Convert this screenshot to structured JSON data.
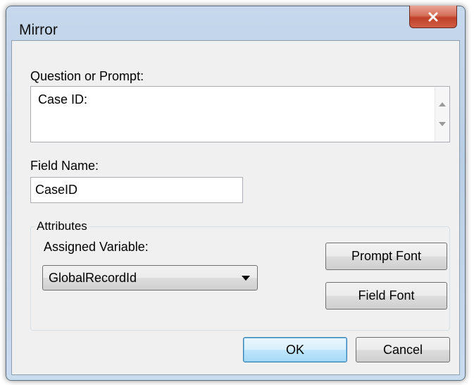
{
  "window": {
    "title": "Mirror",
    "close_glyph": "✕"
  },
  "prompt": {
    "label": "Question or Prompt:",
    "value": "Case ID:"
  },
  "field": {
    "label": "Field Name:",
    "value": "CaseID"
  },
  "attributes": {
    "legend": "Attributes",
    "assigned_label": "Assigned Variable:",
    "assigned_value": "GlobalRecordId",
    "prompt_font_label": "Prompt Font",
    "field_font_label": "Field Font"
  },
  "buttons": {
    "ok": "OK",
    "cancel": "Cancel"
  },
  "icons": {
    "close": "close-icon",
    "dropdown": "chevron-down-icon",
    "scroll_up": "scroll-up-icon",
    "scroll_down": "scroll-down-icon"
  }
}
